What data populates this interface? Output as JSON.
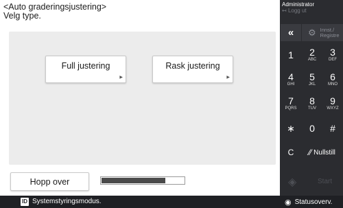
{
  "main": {
    "title": "<Auto graderingsjustering>",
    "subtitle": "Velg type.",
    "options": [
      {
        "label": "Full justering"
      },
      {
        "label": "Rask justering"
      }
    ],
    "skip_label": "Hopp over",
    "progress_fraction": 0.78
  },
  "status_bar": {
    "system_icon": "ID",
    "system_text": "Systemstyringsmodus.",
    "monitor_label": "Statusoverv."
  },
  "keypad": {
    "admin_label": "Administrator",
    "logout_label": "Logg ut",
    "settings_label_line1": "Innst./",
    "settings_label_line2": "Registre",
    "keys": [
      {
        "num": "1",
        "sub": ""
      },
      {
        "num": "2",
        "sub": "ABC"
      },
      {
        "num": "3",
        "sub": "DEF"
      },
      {
        "num": "4",
        "sub": "GHI"
      },
      {
        "num": "5",
        "sub": "JKL"
      },
      {
        "num": "6",
        "sub": "MNO"
      },
      {
        "num": "7",
        "sub": "PQRS"
      },
      {
        "num": "8",
        "sub": "TUV"
      },
      {
        "num": "9",
        "sub": "WXYZ"
      },
      {
        "num": "∗",
        "sub": ""
      },
      {
        "num": "0",
        "sub": ""
      },
      {
        "num": "#",
        "sub": ""
      }
    ],
    "clear_label": "C",
    "reset_label": "Nullstill",
    "start_label": "Start"
  }
}
